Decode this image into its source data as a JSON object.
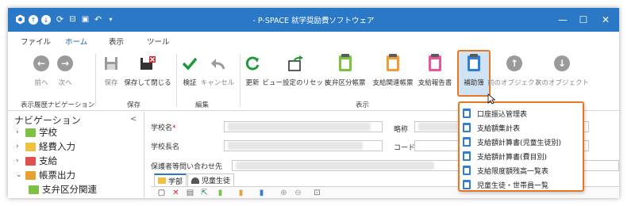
{
  "window": {
    "title": "- P-SPACE 就学奨励費ソフトウェア",
    "quick_access": [
      "app-icon",
      "up-circle-icon",
      "down-circle-icon",
      "refresh-icon",
      "pin-icon",
      "save-all-icon",
      "undo-icon",
      "dropdown-icon"
    ],
    "controls": [
      "minimize",
      "maximize",
      "close"
    ]
  },
  "menu": {
    "tabs": [
      "ファイル",
      "ホーム",
      "表示",
      "ツール"
    ],
    "active": "ホーム"
  },
  "ribbon": {
    "buttons": {
      "prev": "前へ",
      "next": "次へ",
      "save": "保存",
      "save_close": "保存して閉じる",
      "verify": "検証",
      "cancel": "キャンセル",
      "refresh": "更新",
      "reset_view": "ビュー設定のリセット",
      "support_class_form": "支弁区分帳票",
      "payment_form": "支給関連帳票",
      "payment_report": "支給報告書",
      "aux_book": "補助簿",
      "prev_object": "前のオブジェクト",
      "next_object": "次のオブジェクト"
    },
    "groups": {
      "history_nav": "表示履歴ナビゲーション",
      "save": "保存",
      "edit": "編集",
      "view": "表示"
    },
    "colors": {
      "verify": "#1e9a3a",
      "refresh": "#1e9a3a",
      "support_class": "#7cc142",
      "payment": "#f29c38",
      "report": "#e8559b",
      "aux": "#2e7dd6",
      "highlight": "#e87722"
    }
  },
  "dropdown": {
    "items": [
      "口座振込管理表",
      "支給額集計表",
      "支給額計算書(児童生徒別)",
      "支給額計算書(費目別)",
      "支給限度額残高一覧表",
      "児童生徒・世帯員一覧"
    ]
  },
  "nav": {
    "title": "ナビゲーション",
    "collapse": "<",
    "items": [
      {
        "label": "学校",
        "arrow": "›",
        "icon_color": "#7cc142"
      },
      {
        "label": "経費入力",
        "arrow": "›",
        "icon_color": "#f0c040"
      },
      {
        "label": "支給",
        "arrow": "›",
        "icon_color": "#e05050"
      },
      {
        "label": "帳票出力",
        "arrow": "⌄",
        "icon_color": "#e8a030"
      },
      {
        "label": "支弁区分関連",
        "arrow": "",
        "icon_color": "#7cc142"
      }
    ]
  },
  "form": {
    "school_name_label": "学校名",
    "required_mark": "*",
    "principal_label": "学校長名",
    "guardian_contact_label": "保護者等問い合わせ先",
    "abbr_label": "略称",
    "code_label": "コード",
    "subtabs": [
      "学部",
      "児童生徒"
    ]
  }
}
